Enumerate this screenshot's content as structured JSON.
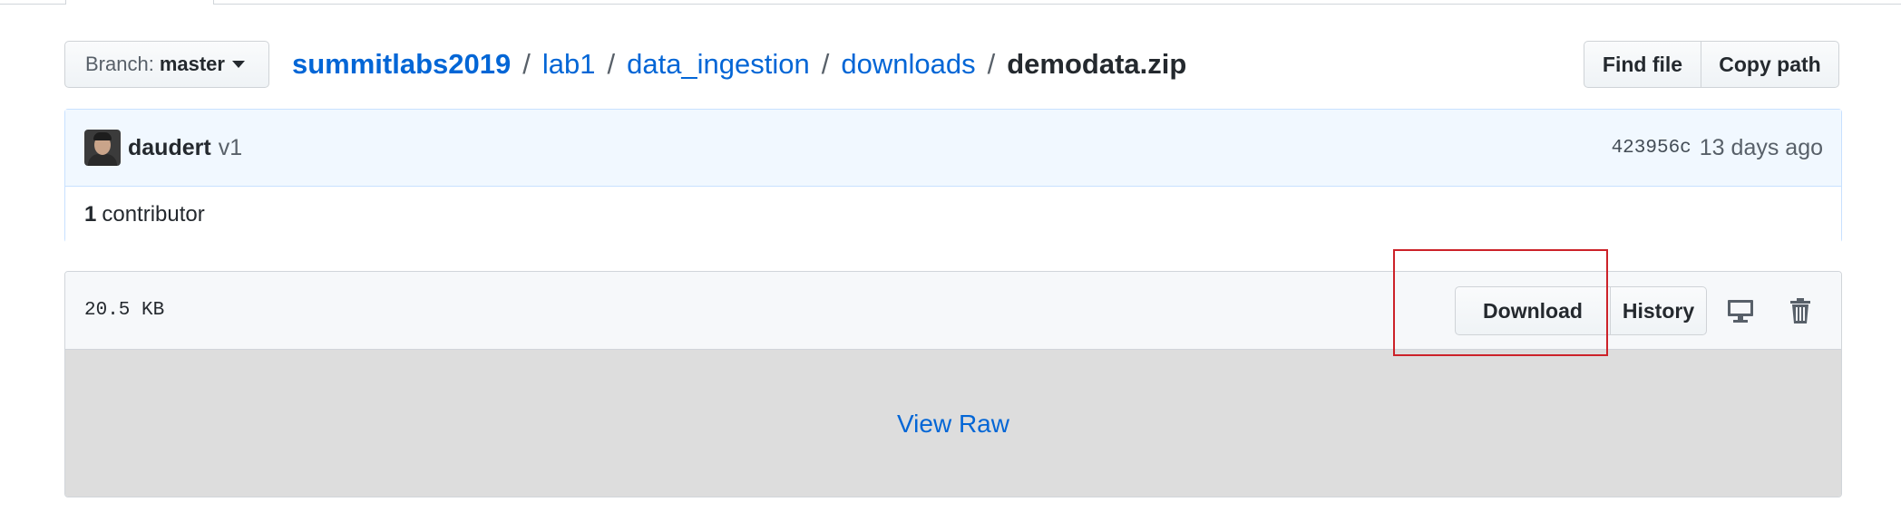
{
  "branch": {
    "prefix": "Branch:",
    "name": "master"
  },
  "breadcrumb": {
    "repo": "summitlabs2019",
    "parts": [
      "lab1",
      "data_ingestion",
      "downloads"
    ],
    "separator": "/",
    "file": "demodata.zip"
  },
  "file_nav": {
    "find_file": "Find file",
    "copy_path": "Copy path"
  },
  "commit": {
    "author": "daudert",
    "message": "v1",
    "sha": "423956c",
    "time": "13 days ago",
    "contributor_count": "1",
    "contributor_label": "contributor"
  },
  "file": {
    "size": "20.5 KB",
    "download_label": "Download",
    "history_label": "History",
    "view_raw_label": "View Raw"
  },
  "icons": {
    "desktop": "desktop-icon",
    "trash": "trash-icon",
    "caret": "caret-down-icon"
  },
  "colors": {
    "link": "#0366d6",
    "highlight": "#cc2229",
    "commit_bg": "#f1f8ff",
    "raw_bg": "#dddddd"
  }
}
